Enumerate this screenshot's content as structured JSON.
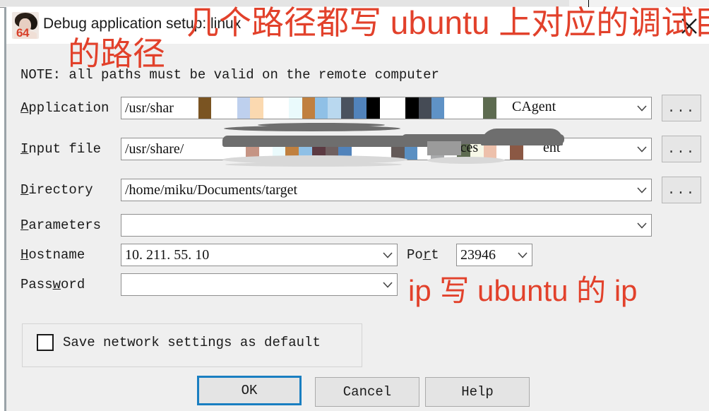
{
  "window": {
    "title": "Debug application setup: linux",
    "avatar_badge": "64",
    "avatar_name": "user-avatar",
    "close_icon": "close-icon"
  },
  "note": "NOTE: all paths must be valid on the remote computer",
  "fields": [
    {
      "id": "application",
      "label_prefix": "",
      "label_accel": "A",
      "label_rest": "pplication",
      "value_visible": "/usr/shar",
      "value_tail": "CAgent",
      "redacted": true,
      "has_browse": true,
      "browse_label": "..."
    },
    {
      "id": "input-file",
      "label_prefix": "",
      "label_accel": "I",
      "label_rest": "nput file",
      "value_visible": "/usr/share/",
      "value_tail": "ent",
      "value_mid": "rces",
      "redacted": true,
      "has_browse": true,
      "browse_label": "..."
    },
    {
      "id": "directory",
      "label_prefix": "",
      "label_accel": "D",
      "label_rest": "irectory",
      "value_visible": "/home/miku/Documents/target",
      "redacted": false,
      "has_browse": true,
      "browse_label": "..."
    },
    {
      "id": "parameters",
      "label_prefix": "",
      "label_accel": "P",
      "label_rest": "arameters",
      "value_visible": "",
      "redacted": false,
      "has_browse": false
    },
    {
      "id": "hostname",
      "label_prefix": "",
      "label_accel": "H",
      "label_rest": "ostname",
      "value_visible": "10. 211. 55. 10",
      "redacted": false,
      "has_browse": false
    },
    {
      "id": "password",
      "label_prefix": "Pass",
      "label_accel": "w",
      "label_rest": "ord",
      "value_visible": "",
      "redacted": false,
      "has_browse": false
    }
  ],
  "port": {
    "label_prefix": "Po",
    "label_accel": "r",
    "label_rest": "t",
    "value": "23946"
  },
  "checkbox": {
    "label": "Save network settings as default",
    "checked": false
  },
  "buttons": {
    "ok": "OK",
    "cancel": "Cancel",
    "help": "Help"
  },
  "annotations": [
    {
      "id": "paths-note-line1",
      "text": "几个路径都写 ubuntu 上对应的调试目标"
    },
    {
      "id": "paths-note-line2",
      "text": "的路径"
    },
    {
      "id": "ip-note",
      "text": "ip 写 ubuntu 的 ip"
    }
  ],
  "colors": {
    "accent_focus": "#1a7fc1",
    "annotation_red": "#e2412b",
    "dialog_bg": "#efefef",
    "field_bg": "#ffffff",
    "border": "#8f8f8f"
  },
  "redaction": {
    "application_stripes": [
      "#7a5422",
      "#ffffff",
      "#ffffff",
      "#bed0ee",
      "#fbd9b0",
      "#ffffff",
      "#ffffff",
      "#eafafc",
      "#c0803f",
      "#8fc0e6",
      "#b9d8ef",
      "#4a525e",
      "#5183bb",
      "#000000",
      "#ffffff",
      "#ffffff",
      "#000000",
      "#454b55",
      "#5f92c6",
      "#ffffff",
      "#ffffff",
      "#ffffff",
      "#5d6b50",
      "#ffffff"
    ],
    "input_stripes": [
      "#ffffff",
      "#ffffff",
      "#c59484",
      "#ffffff",
      "#eafafc",
      "#c0803f",
      "#8fc0e6",
      "#5c3a42",
      "#6f6060",
      "#5183bb",
      "#ffffff",
      "#ffffff",
      "#ffffff",
      "#645a58",
      "#5a8fc2",
      "#ffffff",
      "#a9aaac",
      "#ffffff",
      "#5d6b50",
      "#f7f8e8",
      "#edc0ab",
      "#ffffff",
      "#8b5844"
    ]
  }
}
